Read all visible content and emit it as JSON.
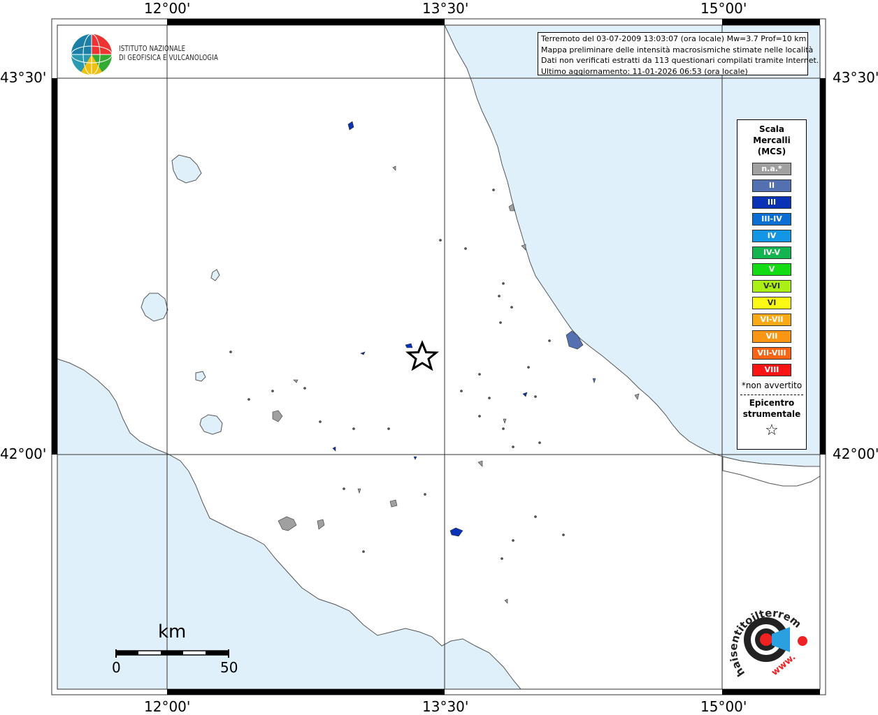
{
  "axes": {
    "lon_top": [
      "12°00'",
      "13°30'",
      "15°00'"
    ],
    "lon_bottom": [
      "12°00'",
      "13°30'",
      "15°00'"
    ],
    "lat_left": [
      "43°30'",
      "42°00'"
    ],
    "lat_right": [
      "43°30'",
      "42°00'"
    ]
  },
  "logo": {
    "line1": "ISTITUTO NAZIONALE",
    "line2": "DI GEOFISICA E VULCANOLOGIA"
  },
  "info": {
    "line1": "Terremoto del 03-07-2009 13:03:07 (ora locale) Mw=3.7 Prof=10 km",
    "line2": "Mappa preliminare delle intensità macrosismiche stimate nelle località",
    "line3": "Dati non verificati estratti da 113 questionari compilati tramite Internet.",
    "line4": "Ultimo aggiornamento: 11-01-2026 06:53 (ora locale)"
  },
  "legend": {
    "title1": "Scala",
    "title2": "Mercalli",
    "title3": "(MCS)",
    "items": [
      {
        "label": "n.a.*",
        "color": "#a0a0a0"
      },
      {
        "label": "II",
        "color": "#5470b0"
      },
      {
        "label": "III",
        "color": "#0a32b4"
      },
      {
        "label": "III-IV",
        "color": "#0a6ed2"
      },
      {
        "label": "IV",
        "color": "#1496e6"
      },
      {
        "label": "IV-V",
        "color": "#14b450"
      },
      {
        "label": "V",
        "color": "#14dc14"
      },
      {
        "label": "V-VI",
        "color": "#aaf014"
      },
      {
        "label": "VI",
        "color": "#fafa14"
      },
      {
        "label": "VI-VII",
        "color": "#faaa14"
      },
      {
        "label": "VII",
        "color": "#fa9614"
      },
      {
        "label": "VII-VIII",
        "color": "#fa6414"
      },
      {
        "label": "VIII",
        "color": "#fa1414"
      }
    ],
    "note": "*non avvertito",
    "epicenter1": "Epicentro",
    "epicenter2": "strumentale",
    "star": "☆"
  },
  "scale": {
    "unit": "km",
    "start": "0",
    "end": "50"
  },
  "brand": {
    "text": "haisentitoilterremoto.it",
    "www": "www."
  },
  "colors": {
    "sea": "#e0f0fa",
    "land": "#ffffff",
    "intensity_II": "#5470b0",
    "intensity_III": "#0a32b4",
    "na": "#a0a0a0"
  }
}
